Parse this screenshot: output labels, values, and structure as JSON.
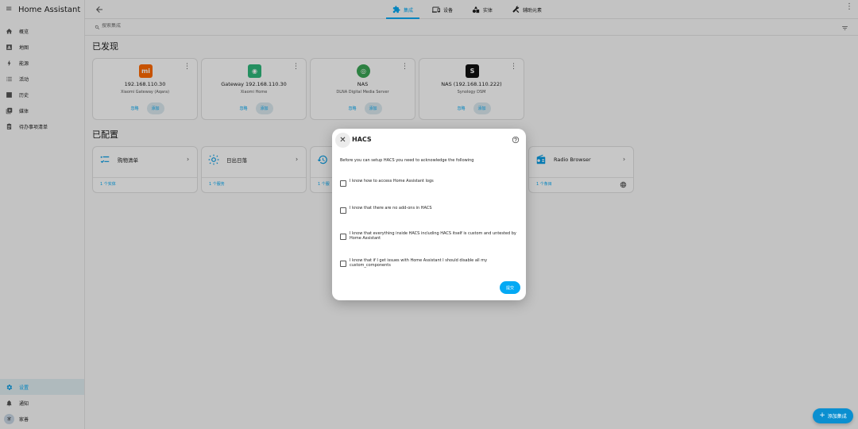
{
  "app": {
    "title": "Home Assistant"
  },
  "sidebar": {
    "items": [
      {
        "label": "概览",
        "icon": "home-icon"
      },
      {
        "label": "地图",
        "icon": "map-icon"
      },
      {
        "label": "能源",
        "icon": "lightning-icon"
      },
      {
        "label": "活动",
        "icon": "list-icon"
      },
      {
        "label": "历史",
        "icon": "chart-icon"
      },
      {
        "label": "媒体",
        "icon": "media-icon"
      },
      {
        "label": "待办事项清单",
        "icon": "clipboard-icon"
      }
    ],
    "bottom": [
      {
        "label": "设置",
        "icon": "gear-icon",
        "active": true
      },
      {
        "label": "通知",
        "icon": "bell-icon"
      },
      {
        "label": "家善",
        "avatar": "家"
      }
    ]
  },
  "topbar": {
    "tabs": [
      {
        "label": "集成",
        "icon": "puzzle-icon",
        "active": true
      },
      {
        "label": "设备",
        "icon": "devices-icon"
      },
      {
        "label": "实体",
        "icon": "entities-icon"
      },
      {
        "label": "辅助元素",
        "icon": "tools-icon"
      }
    ]
  },
  "search": {
    "placeholder": "搜索集成"
  },
  "discovered": {
    "title": "已发现",
    "cards": [
      {
        "name": "192.168.110.30",
        "sub": "Xiaomi Gateway (Aqara)",
        "logo_text": "mi",
        "logo_color": "#ff6900",
        "ignore": "忽略",
        "add": "添加"
      },
      {
        "name": "Gateway 192.168.110.30",
        "sub": "Xiaomi Home",
        "logo_text": "◉",
        "logo_color": "#2fb87b",
        "ignore": "忽略",
        "add": "添加"
      },
      {
        "name": "NAS",
        "sub": "DLNA Digital Media Server",
        "logo_text": "◎",
        "logo_color": "#3aa655",
        "ignore": "忽略",
        "add": "添加"
      },
      {
        "name": "NAS (192.168.110.222)",
        "sub": "Synology DSM",
        "logo_text": "S",
        "logo_color": "#111111",
        "ignore": "忽略",
        "add": "添加"
      }
    ]
  },
  "configured": {
    "title": "已配置",
    "cards": [
      {
        "label": "购物清单",
        "icon": "checklist-icon",
        "link": "1 个实体"
      },
      {
        "label": "日出日落",
        "icon": "sun-icon",
        "link": "1 个服务"
      },
      {
        "label": "",
        "icon": "backup-icon",
        "link": "1 个服"
      },
      {
        "label": "Radio Browser",
        "icon": "radio-icon",
        "link": "1 个条目",
        "globe": true
      }
    ]
  },
  "dialog": {
    "title": "HACS",
    "intro": "Before you can setup HACS you need to acknowledge the following",
    "checks": [
      "I know how to access Home Assistant logs",
      "I know that there are no add-ons in HACS",
      "I know that everything inside HACS including HACS itself is custom and untested by Home Assistant",
      "I know that if I get issues with Home Assistant I should disable all my custom_components"
    ],
    "submit": "提交"
  },
  "fab": {
    "label": "添加集成"
  }
}
